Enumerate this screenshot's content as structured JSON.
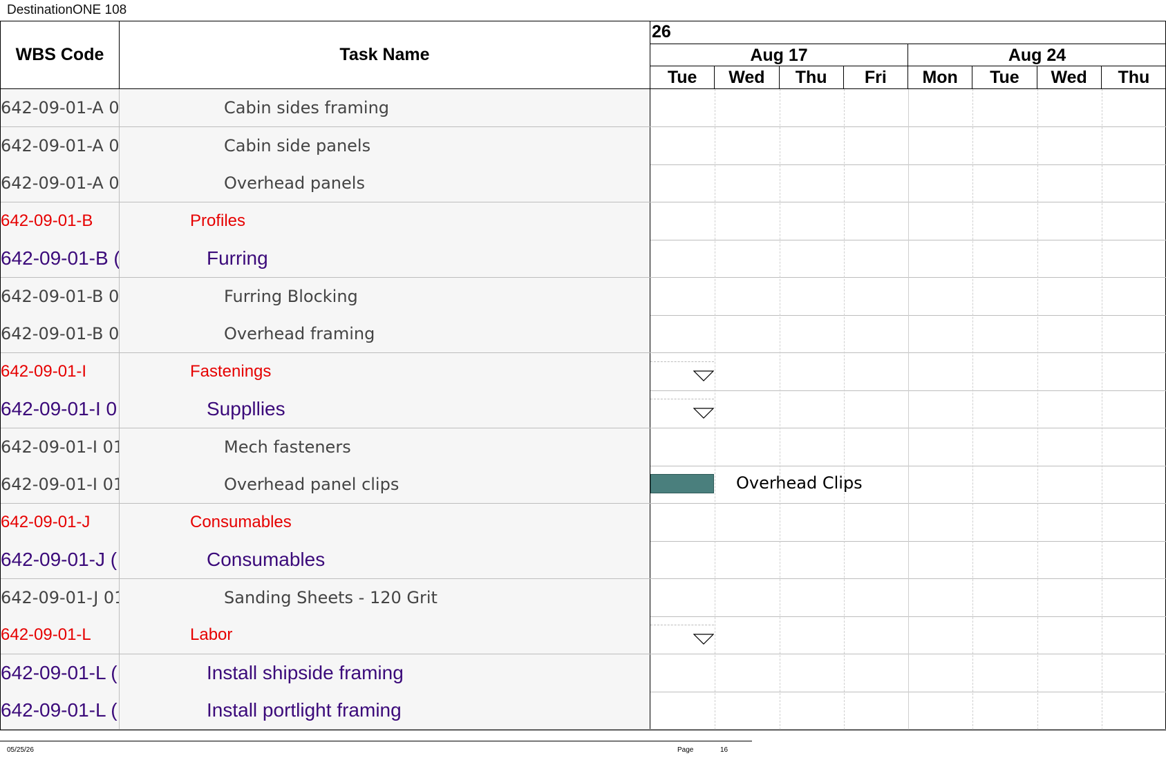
{
  "document_title": "DestinationONE 108",
  "headers": {
    "wbs": "WBS Code",
    "task": "Task Name"
  },
  "timescale": {
    "top_label": "26",
    "weeks": [
      "Aug 17",
      "Aug 24"
    ],
    "days": [
      "Tue",
      "Wed",
      "Thu",
      "Fri",
      "Mon",
      "Tue",
      "Wed",
      "Thu"
    ]
  },
  "rows": [
    {
      "wbs": "642-09-01-A 0",
      "task": "Cabin sides framing",
      "level": 3
    },
    {
      "wbs": "642-09-01-A 0",
      "task": "Cabin side panels",
      "level": 3
    },
    {
      "wbs": "642-09-01-A 0",
      "task": "Overhead panels",
      "level": 3
    },
    {
      "wbs": "642-09-01-B",
      "task": "Profiles",
      "level": 1
    },
    {
      "wbs": "642-09-01-B (",
      "task": "Furring",
      "level": 2
    },
    {
      "wbs": "642-09-01-B 0",
      "task": "Furring Blocking",
      "level": 3
    },
    {
      "wbs": "642-09-01-B 0",
      "task": "Overhead framing",
      "level": 3
    },
    {
      "wbs": "642-09-01-I",
      "task": "Fastenings",
      "level": 1,
      "summary": true
    },
    {
      "wbs": "642-09-01-I 0",
      "task": "Suppllies",
      "level": 2,
      "summary": true
    },
    {
      "wbs": "642-09-01-I 01",
      "task": "Mech fasteners",
      "level": 3
    },
    {
      "wbs": "642-09-01-I 01",
      "task": "Overhead panel clips",
      "level": 3,
      "bar": true,
      "bar_label": "Overhead Clips"
    },
    {
      "wbs": "642-09-01-J",
      "task": "Consumables",
      "level": 1
    },
    {
      "wbs": "642-09-01-J (",
      "task": "Consumables",
      "level": 2
    },
    {
      "wbs": "642-09-01-J 01",
      "task": "Sanding Sheets - 120 Grit",
      "level": 3
    },
    {
      "wbs": "642-09-01-L",
      "task": "Labor",
      "level": 1,
      "summary": true
    },
    {
      "wbs": "642-09-01-L (",
      "task": "Install shipside framing",
      "level": 2
    },
    {
      "wbs": "642-09-01-L (",
      "task": "Install portlight framing",
      "level": 2
    }
  ],
  "footer": {
    "date": "05/25/26",
    "page_label": "Page",
    "page_number": "16"
  },
  "colors": {
    "summary_level1": "#e60000",
    "summary_level2": "#3b0a7a",
    "task": "#444444",
    "bar": "#4a7f7d"
  }
}
